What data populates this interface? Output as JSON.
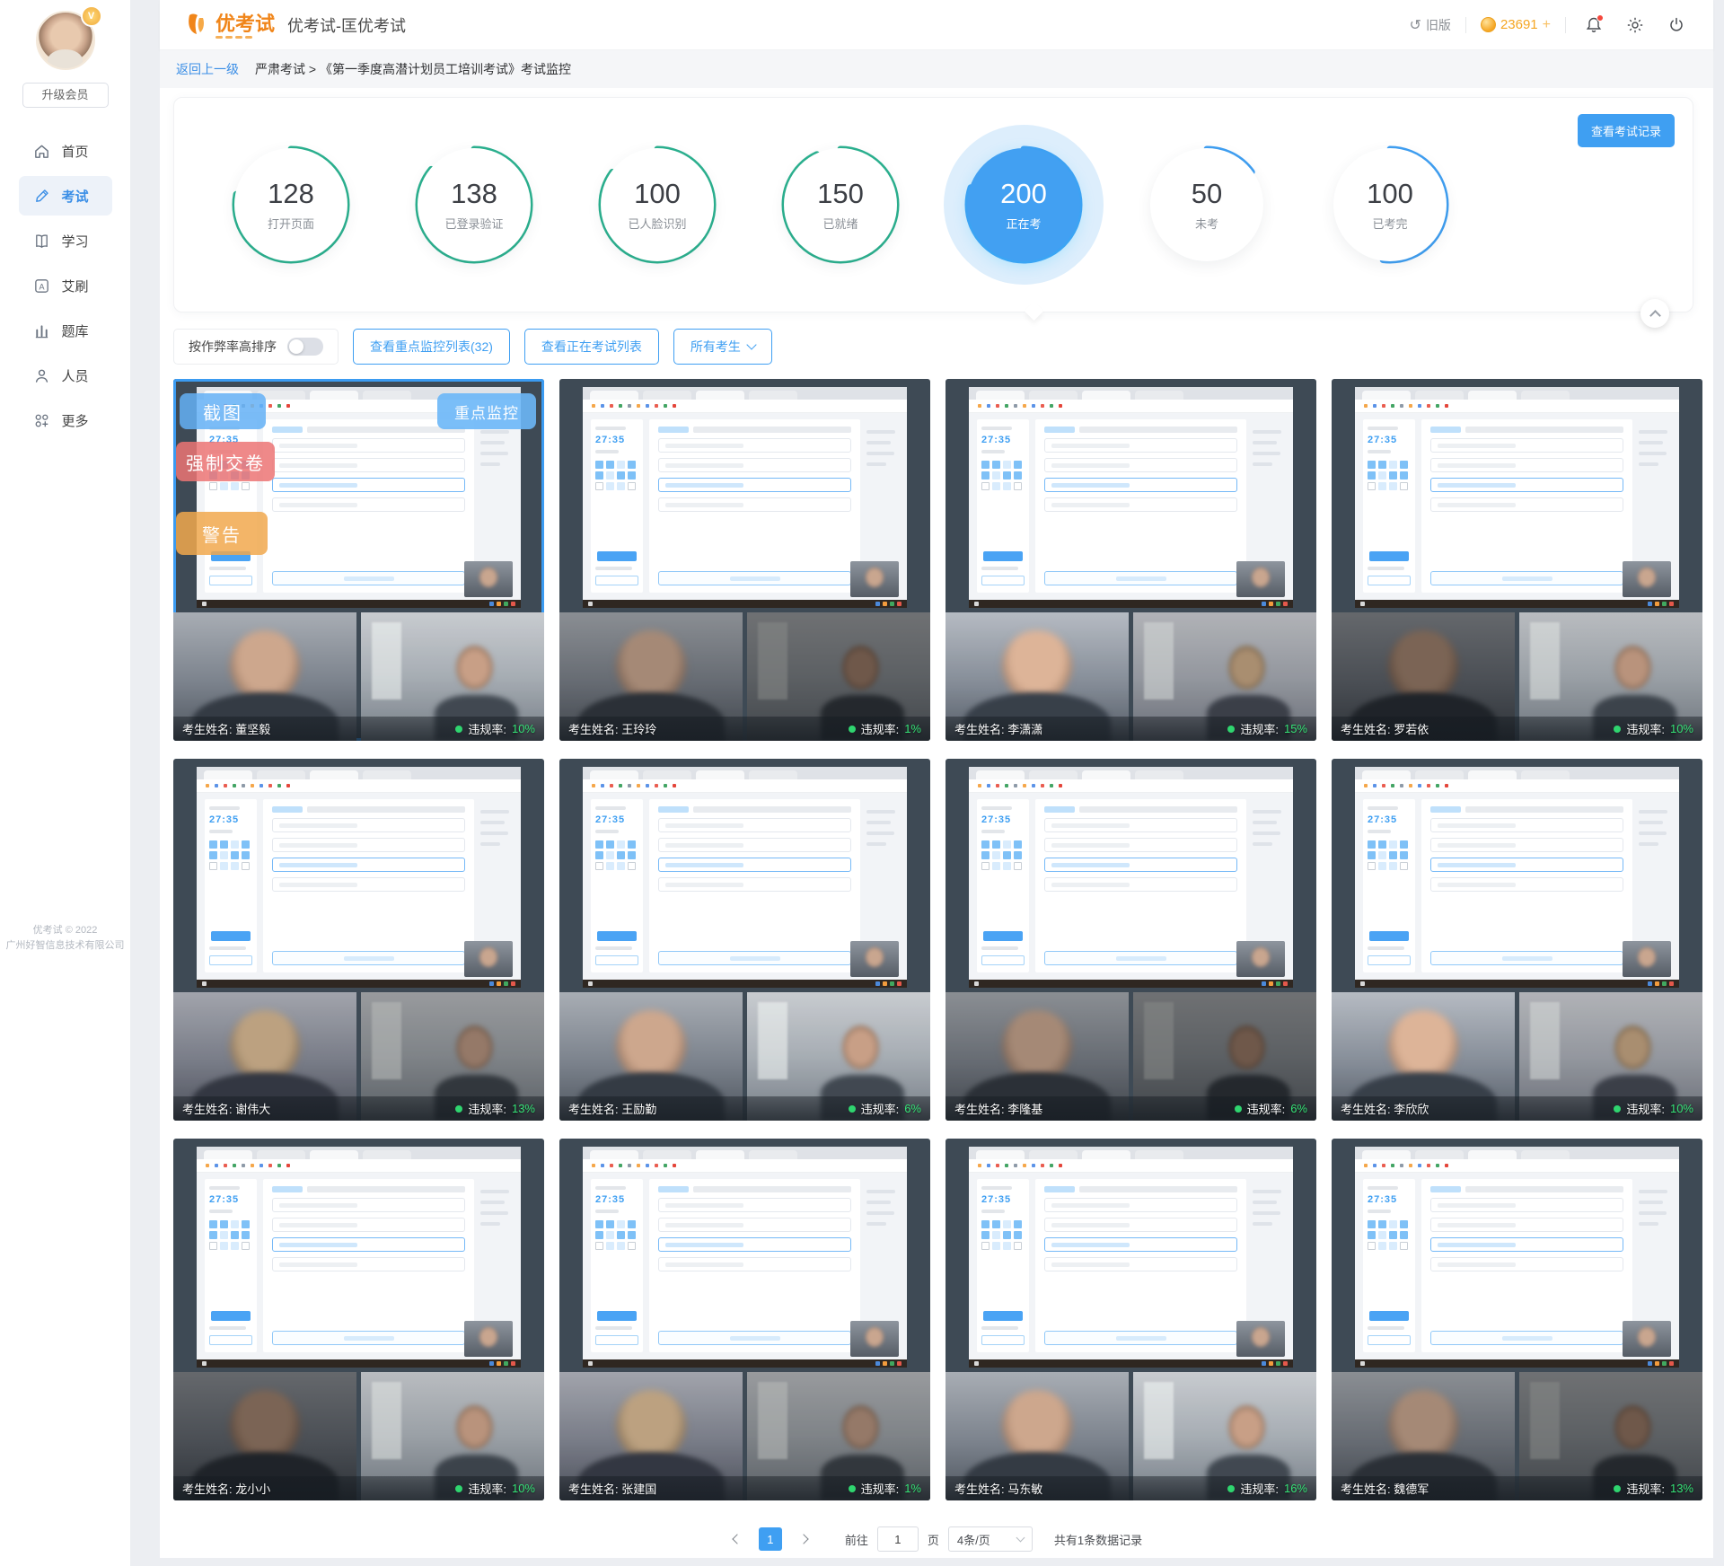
{
  "header": {
    "brand": "优考试",
    "title": "优考试-匡优考试",
    "old_version": "旧版",
    "points": "23691",
    "points_plus": "+"
  },
  "breadcrumb": {
    "back": "返回上一级",
    "path": "严肃考试 > 《第一季度高潜计划员工培训考试》考试监控"
  },
  "sidebar": {
    "upgrade": "升级会员",
    "items": [
      {
        "label": "首页",
        "icon": "home-icon",
        "active": false
      },
      {
        "label": "考试",
        "icon": "exam-icon",
        "active": true
      },
      {
        "label": "学习",
        "icon": "study-icon",
        "active": false
      },
      {
        "label": "艾刷",
        "icon": "brush-icon",
        "active": false
      },
      {
        "label": "题库",
        "icon": "question-bank-icon",
        "active": false
      },
      {
        "label": "人员",
        "icon": "people-icon",
        "active": false
      },
      {
        "label": "更多",
        "icon": "more-icon",
        "active": false
      }
    ],
    "footer_line1": "优考试 © 2022",
    "footer_line2": "广州好智信息技术有限公司"
  },
  "stats": {
    "view_records_label": "查看考试记录",
    "circles": [
      {
        "value": "128",
        "label": "打开页面",
        "color": "#2bb18f",
        "progress": 0.78,
        "active": false
      },
      {
        "value": "138",
        "label": "已登录验证",
        "color": "#2bb18f",
        "progress": 0.86,
        "active": false
      },
      {
        "value": "100",
        "label": "已人脸识别",
        "color": "#2bb18f",
        "progress": 0.85,
        "active": false
      },
      {
        "value": "150",
        "label": "已就绪",
        "color": "#2bb18f",
        "progress": 0.93,
        "active": false
      },
      {
        "value": "200",
        "label": "正在考",
        "color": "#3f9ff2",
        "progress": 0.8,
        "active": true
      },
      {
        "value": "50",
        "label": "未考",
        "color": "#3f9ff2",
        "progress": 0.15,
        "active": false
      },
      {
        "value": "100",
        "label": "已考完",
        "color": "#3f9ff2",
        "progress": 0.52,
        "active": false
      }
    ]
  },
  "filters": {
    "sort_label": "按作弊率高排序",
    "sort_on": false,
    "monitor_list_label": "查看重点监控列表(32)",
    "ongoing_list_label": "查看正在考试列表",
    "candidate_filter_label": "所有考生"
  },
  "card_overlay": {
    "screenshot": "截图",
    "force_submit": "强制交卷",
    "warning": "警告",
    "key_monitor": "重点监控"
  },
  "exam_mock": {
    "timer": "27:35"
  },
  "candidates": {
    "name_label": "考生姓名",
    "rate_label": "违规率",
    "list": [
      {
        "name": "董坚毅",
        "rate": "10%",
        "selected": true
      },
      {
        "name": "王玲玲",
        "rate": "1%",
        "selected": false
      },
      {
        "name": "李潇潇",
        "rate": "15%",
        "selected": false
      },
      {
        "name": "罗若依",
        "rate": "10%",
        "selected": false
      },
      {
        "name": "谢伟大",
        "rate": "13%",
        "selected": false
      },
      {
        "name": "王励勤",
        "rate": "6%",
        "selected": false
      },
      {
        "name": "李隆基",
        "rate": "6%",
        "selected": false
      },
      {
        "name": "李欣欣",
        "rate": "10%",
        "selected": false
      },
      {
        "name": "龙小小",
        "rate": "10%",
        "selected": false
      },
      {
        "name": "张建国",
        "rate": "1%",
        "selected": false
      },
      {
        "name": "马东敏",
        "rate": "16%",
        "selected": false
      },
      {
        "name": "魏德军",
        "rate": "13%",
        "selected": false
      }
    ]
  },
  "pagination": {
    "page": "1",
    "goto_label": "前往",
    "page_input": "1",
    "page_unit": "页",
    "page_size": "4条/页",
    "total_label": "共有1条数据记录"
  }
}
